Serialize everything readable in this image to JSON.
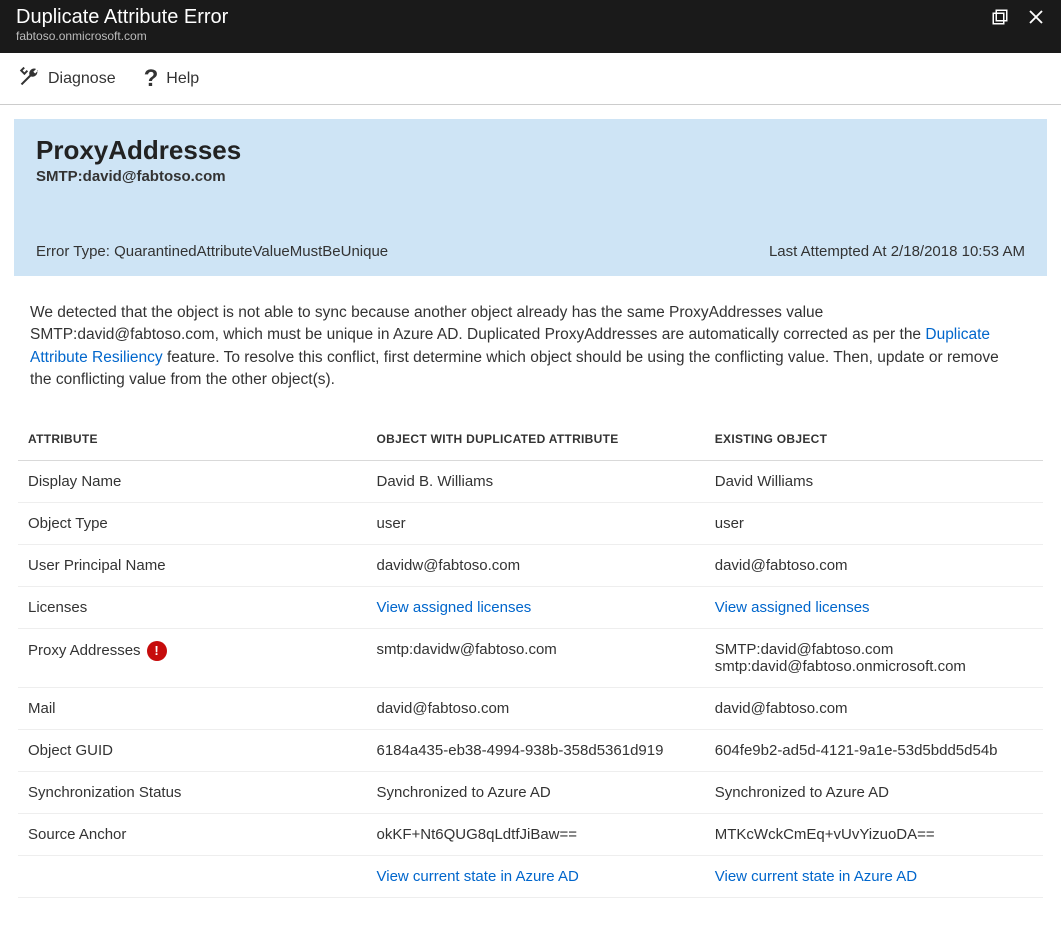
{
  "header": {
    "title": "Duplicate Attribute Error",
    "subtitle": "fabtoso.onmicrosoft.com"
  },
  "toolbar": {
    "diagnose": "Diagnose",
    "help": "Help"
  },
  "banner": {
    "title": "ProxyAddresses",
    "subtitle": "SMTP:david@fabtoso.com",
    "error_type_label": "Error Type: QuarantinedAttributeValueMustBeUnique",
    "last_attempted": "Last Attempted At 2/18/2018 10:53 AM"
  },
  "description": {
    "t1": "We detected that the object is not able to sync because another object already has the same ProxyAddresses value SMTP:david@fabtoso.com, which must be unique in Azure AD. Duplicated ProxyAddresses are automatically corrected as per the ",
    "link": "Duplicate Attribute Resiliency",
    "t2": " feature. To resolve this conflict, first determine which object should be using the conflicting value. Then, update or remove the conflicting value from the other object(s)."
  },
  "table": {
    "headers": {
      "attribute": "ATTRIBUTE",
      "duplicated": "OBJECT WITH DUPLICATED ATTRIBUTE",
      "existing": "EXISTING OBJECT"
    },
    "view_licenses": "View assigned licenses",
    "view_state": "View current state in Azure AD",
    "rows": {
      "display_name": {
        "label": "Display Name",
        "dup": "David B. Williams",
        "ex": "David Williams"
      },
      "object_type": {
        "label": "Object Type",
        "dup": "user",
        "ex": "user"
      },
      "upn": {
        "label": "User Principal Name",
        "dup": "davidw@fabtoso.com",
        "ex": "david@fabtoso.com"
      },
      "licenses": {
        "label": "Licenses"
      },
      "proxy": {
        "label": "Proxy Addresses",
        "dup": "smtp:davidw@fabtoso.com",
        "ex1": "SMTP:david@fabtoso.com",
        "ex2": "smtp:david@fabtoso.onmicrosoft.com"
      },
      "mail": {
        "label": "Mail",
        "dup": "david@fabtoso.com",
        "ex": "david@fabtoso.com"
      },
      "guid": {
        "label": "Object GUID",
        "dup": "6184a435-eb38-4994-938b-358d5361d919",
        "ex": "604fe9b2-ad5d-4121-9a1e-53d5bdd5d54b"
      },
      "sync": {
        "label": "Synchronization Status",
        "dup": "Synchronized to Azure AD",
        "ex": "Synchronized to Azure AD"
      },
      "anchor": {
        "label": "Source Anchor",
        "dup": "okKF+Nt6QUG8qLdtfJiBaw==",
        "ex": "MTKcWckCmEq+vUvYizuoDA=="
      }
    }
  }
}
